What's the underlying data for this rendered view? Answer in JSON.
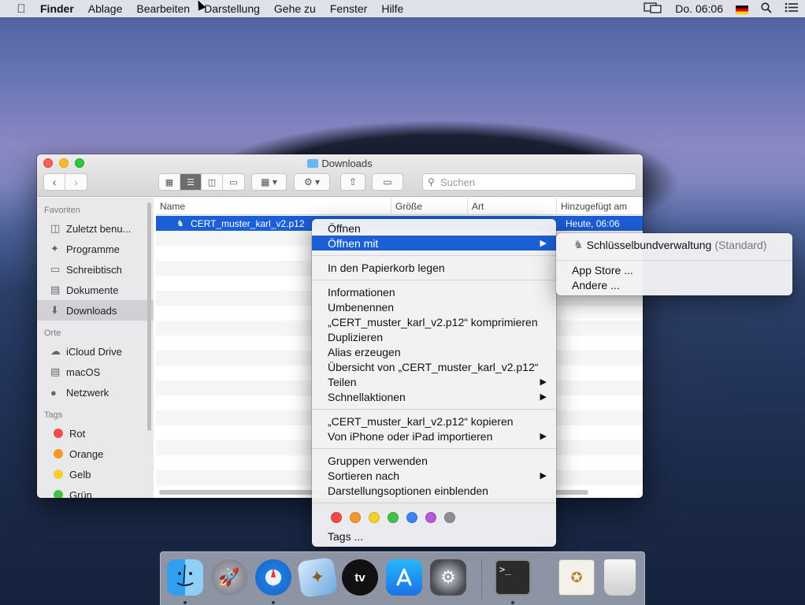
{
  "menubar": {
    "apple": "",
    "items": [
      "Finder",
      "Ablage",
      "Bearbeiten",
      "Darstellung",
      "Gehe zu",
      "Fenster",
      "Hilfe"
    ],
    "clock": "Do. 06:06"
  },
  "window": {
    "title": "Downloads",
    "search_placeholder": "Suchen",
    "sidebar": {
      "favorites_header": "Favoriten",
      "favorites": [
        "Zuletzt benu...",
        "Programme",
        "Schreibtisch",
        "Dokumente",
        "Downloads"
      ],
      "places_header": "Orte",
      "places": [
        "iCloud Drive",
        "macOS",
        "Netzwerk"
      ],
      "tags_header": "Tags",
      "tags": [
        {
          "label": "Rot",
          "color": "#f14c4c"
        },
        {
          "label": "Orange",
          "color": "#f5962b"
        },
        {
          "label": "Gelb",
          "color": "#f6cf2a"
        },
        {
          "label": "Grün",
          "color": "#43c04b"
        }
      ]
    },
    "columns": [
      "Name",
      "Größe",
      "Art",
      "Hinzugefügt am"
    ],
    "selected_file": {
      "name": "CERT_muster_karl_v2.p12",
      "added": "Heute, 06:06"
    }
  },
  "context_menu": {
    "open": "Öffnen",
    "open_with": "Öffnen mit",
    "trash": "In den Papierkorb legen",
    "info": "Informationen",
    "rename": "Umbenennen",
    "compress": "„CERT_muster_karl_v2.p12“ komprimieren",
    "duplicate": "Duplizieren",
    "alias": "Alias erzeugen",
    "quicklook": "Übersicht von „CERT_muster_karl_v2.p12“",
    "share": "Teilen",
    "quick_actions": "Schnellaktionen",
    "copy": "„CERT_muster_karl_v2.p12“ kopieren",
    "import": "Von iPhone oder iPad importieren",
    "use_groups": "Gruppen verwenden",
    "sort_by": "Sortieren nach",
    "view_options": "Darstellungsoptionen einblenden",
    "tag_colors": [
      "#f14c4c",
      "#f5962b",
      "#f6cf2a",
      "#43c04b",
      "#3b82f6",
      "#b35ad6",
      "#8e8e93"
    ],
    "tags": "Tags ..."
  },
  "submenu": {
    "app": "Schlüsselbundverwaltung",
    "standard": "(Standard)",
    "app_store": "App Store ...",
    "other": "Andere ..."
  },
  "dock": {
    "apps": [
      "finder-icon",
      "launchpad-icon",
      "safari-icon",
      "mail-icon",
      "tv-icon",
      "app-store-icon",
      "system-preferences-icon",
      "terminal-icon",
      "certificate-icon",
      "trash-icon"
    ],
    "tv_label": "tv"
  }
}
